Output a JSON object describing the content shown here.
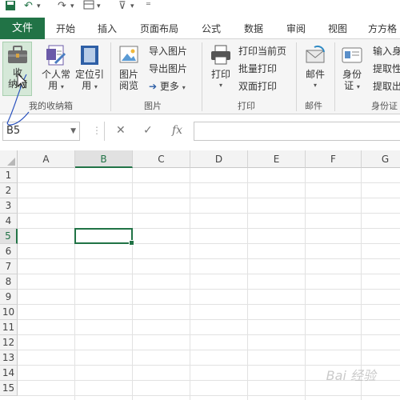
{
  "qat": {
    "undo": "↶",
    "redo": "↷",
    "customize": "⊽",
    "more": "⁼"
  },
  "tabs": [
    "文件",
    "开始",
    "插入",
    "页面布局",
    "公式",
    "数据",
    "审阅",
    "视图",
    "方方格"
  ],
  "ribbon": {
    "favorites": {
      "label_line1": "收",
      "label_line2": "纳箱",
      "group": "我的收纳箱"
    },
    "personal": {
      "line1": "个人常",
      "line2": "用"
    },
    "locate": {
      "line1": "定位引",
      "line2": "用"
    },
    "picture_browse": {
      "line1": "图片",
      "line2": "阅览"
    },
    "import_picture": "导入图片",
    "export_picture": "导出图片",
    "more": "更多",
    "picture_group": "图片",
    "print": "打印",
    "print_current": "打印当前页",
    "batch_print": "批量打印",
    "duplex_print": "双面打印",
    "print_group": "打印",
    "mail": "邮件",
    "mail_group": "邮件",
    "idcard": {
      "line1": "身份",
      "line2": "证"
    },
    "input_id": "输入身",
    "extract1": "提取性",
    "extract2": "提取出",
    "idcard_group": "身份证"
  },
  "formula_bar": {
    "name_box": "B5",
    "cancel": "✕",
    "confirm": "✓",
    "fx": "fx",
    "value": ""
  },
  "columns": [
    "A",
    "B",
    "C",
    "D",
    "E",
    "F",
    "G"
  ],
  "rows": [
    "1",
    "2",
    "3",
    "4",
    "5",
    "6",
    "7",
    "8",
    "9",
    "10",
    "11",
    "12",
    "13",
    "14",
    "15"
  ],
  "selected_cell": {
    "column": "B",
    "row": "5"
  },
  "watermark": "Bai 经验"
}
